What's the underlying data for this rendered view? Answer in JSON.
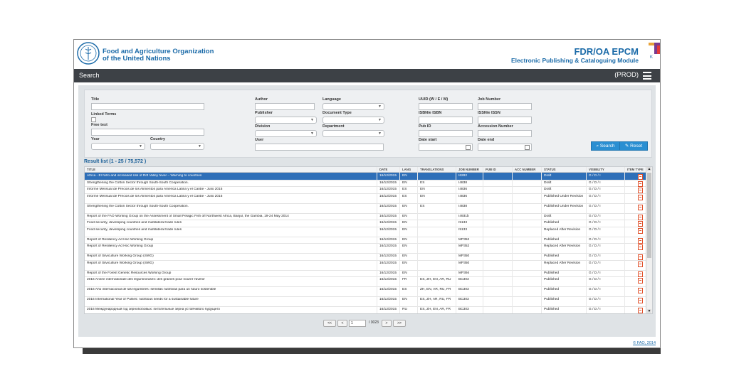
{
  "header": {
    "org_line1": "Food and Agriculture Organization",
    "org_line2": "of the United Nations",
    "title": "FDR/OA EPCM",
    "subtitle": "Electronic Publishing & Cataloguing Module"
  },
  "navbar": {
    "title": "Search",
    "env": "(PROD)"
  },
  "form": {
    "title_label": "Title",
    "linked_terms_label": "Linked Terms",
    "free_text_label": "Free text",
    "year_label": "Year",
    "country_label": "Country",
    "author_label": "Author",
    "publisher_label": "Publisher",
    "division_label": "Division",
    "user_label": "User",
    "language_label": "Language",
    "doctype_label": "Document Type",
    "department_label": "Department",
    "uuid_label": "UUID (W / E / M)",
    "isbn_label": "ISBN/e ISBN",
    "pubid_label": "Pub ID",
    "date_start_label": "Date start",
    "job_number_label": "Job Number",
    "issn_label": "ISSN/e ISSN",
    "accession_label": "Accession Number",
    "date_end_label": "Date end",
    "search_button": "Search",
    "reset_button": "Reset"
  },
  "results": {
    "title": "Result list (1 - 25 / 75,572 )",
    "columns": [
      "TITLE",
      "DATE",
      "LANG",
      "TRANSLATIONS",
      "JOB NUMBER",
      "PUB ID",
      "ACC NUMBER",
      "STATUS",
      "VISIBILITY",
      "ITEM TYPE"
    ],
    "rows": [
      {
        "title": "Africa - El Niño and increased risk of Rift Valley fever – Warning to countries",
        "date": "16/12/2015",
        "lang": "EN",
        "trans": "",
        "job": "I6282",
        "pub": "",
        "acc": "",
        "status": "Draft",
        "vis": "G / D / I"
      },
      {
        "title": "Strengthening the Cotton Sector through South-South Cooperation.",
        "date": "16/12/2015",
        "lang": "EN",
        "trans": "ES",
        "job": "I4838",
        "pub": "",
        "acc": "",
        "status": "Draft",
        "vis": "G / D / I"
      },
      {
        "title": "Informe Mensual de Precios de los Alimentos para América Latina y el Caribe - Julio 2015",
        "date": "16/12/2015",
        "lang": "ES",
        "trans": "EN",
        "job": "I4836",
        "pub": "",
        "acc": "",
        "status": "Draft",
        "vis": "G / D / I"
      },
      {
        "title": "Informe Mensual de Precios de los Alimentos para América Latina y el Caribe - Julio 2015",
        "date": "16/12/2015",
        "lang": "ES",
        "trans": "EN",
        "job": "I4836",
        "pub": "",
        "acc": "",
        "status": "Published Under Revision",
        "vis": "G / D / I"
      },
      {
        "title": "Strengthening the Cotton Sector through South-South Cooperation.",
        "date": "16/12/2015",
        "lang": "EN",
        "trans": "ES",
        "job": "I4838",
        "pub": "",
        "acc": "",
        "status": "Published Under Revision",
        "vis": "G / D / I"
      },
      {
        "title": "Report of the FAO Working Group on the Assessment of Small Pelagic Fish off Northwest Africa, Banjul, the Gambia, 19-24 May 2014",
        "date": "16/12/2015",
        "lang": "EN",
        "trans": "",
        "job": "I4931b",
        "pub": "",
        "acc": "",
        "status": "Draft",
        "vis": "G / D / I"
      },
      {
        "title": "Food security, developing countries and multilateral trade rules",
        "date": "16/12/2015",
        "lang": "EN",
        "trans": "",
        "job": "I5133",
        "pub": "",
        "acc": "",
        "status": "Published",
        "vis": "G / D / I"
      },
      {
        "title": "Food security, developing countries and multilateral trade rules",
        "date": "16/12/2015",
        "lang": "EN",
        "trans": "",
        "job": "I5133",
        "pub": "",
        "acc": "",
        "status": "Replaced After Revision",
        "vis": "G / D / I"
      },
      {
        "title": "Report of Resiliency Ad Hoc Working Group",
        "date": "16/12/2015",
        "lang": "EN",
        "trans": "",
        "job": "MP352",
        "pub": "",
        "acc": "",
        "status": "Published",
        "vis": "G / D / I"
      },
      {
        "title": "Report of Resiliency Ad Hoc Working Group",
        "date": "16/12/2015",
        "lang": "EN",
        "trans": "",
        "job": "MP352",
        "pub": "",
        "acc": "",
        "status": "Replaced After Revision",
        "vis": "G / D / I"
      },
      {
        "title": "Report of Silviculture Working Group (SWG)",
        "date": "16/12/2015",
        "lang": "EN",
        "trans": "",
        "job": "MP350",
        "pub": "",
        "acc": "",
        "status": "Published",
        "vis": "G / D / I"
      },
      {
        "title": "Report of Silviculture Working Group (SWG)",
        "date": "16/12/2015",
        "lang": "EN",
        "trans": "",
        "job": "MP350",
        "pub": "",
        "acc": "",
        "status": "Replaced After Revision",
        "vis": "G / D / I"
      },
      {
        "title": "Report of the Forest Genetic Resources Working Group",
        "date": "16/12/2015",
        "lang": "EN",
        "trans": "",
        "job": "MP394",
        "pub": "",
        "acc": "",
        "status": "Published",
        "vis": "G / D / I"
      },
      {
        "title": "2016 Année internationale des légumineuses: des graines pour nourrir l'avenir",
        "date": "16/12/2015",
        "lang": "FR",
        "trans": "ES, ZH, EN, AR, RU",
        "job": "BC303",
        "pub": "",
        "acc": "",
        "status": "Published",
        "vis": "G / D / I"
      },
      {
        "title": "2016 Año internacional de las legumbres: semillas nutritivas para un futuro sostenible",
        "date": "16/12/2015",
        "lang": "ES",
        "trans": "ZH, EN, AR, RU, FR",
        "job": "BC303",
        "pub": "",
        "acc": "",
        "status": "Published",
        "vis": "G / D / I"
      },
      {
        "title": "2016 International Year of Pulses: nutritious seeds for a sustainable future",
        "date": "16/12/2015",
        "lang": "EN",
        "trans": "ES, ZH, AR, RU, FR",
        "job": "BC303",
        "pub": "",
        "acc": "",
        "status": "Published",
        "vis": "G / D / I"
      },
      {
        "title": "2016 Международный год зернобобовых: питательные зерна устойчивого будущего",
        "date": "16/12/2015",
        "lang": "RU",
        "trans": "ES, ZH, EN, AR, FR",
        "job": "BC303",
        "pub": "",
        "acc": "",
        "status": "Published",
        "vis": "G / D / I"
      },
      {
        "title": "السنة الدولية للبقول 2016: بذور مغذية لمستقبل مستدام",
        "date": "16/12/2015",
        "lang": "AR",
        "trans": "ES, ZH, EN, RU, FR",
        "job": "BC303",
        "pub": "",
        "acc": "",
        "status": "Published",
        "vis": "G / D / I"
      }
    ]
  },
  "pager": {
    "first": "<<",
    "prev": "<",
    "page": "1",
    "total": "/ 3023",
    "next": ">",
    "last": ">>"
  },
  "footer": {
    "copyright": "© FAO, 2014"
  },
  "colors": {
    "accent": "#2a8fd2",
    "navbar": "#3d4146",
    "selected_row": "#2e6fb8"
  }
}
